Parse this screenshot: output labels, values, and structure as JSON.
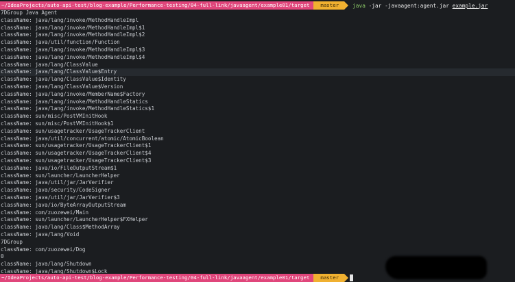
{
  "prompt_top": {
    "path": "~/IdeaProjects/auto-api-test/blog-example/Performance-testing/04-full-link/javaagent/example01/target",
    "branch": "master",
    "cmd_java": "java",
    "cmd_args": "-jar -javaagent:agent.jar",
    "cmd_file": "example.jar"
  },
  "output_lines": [
    "7DGroup Java Agent",
    "className: java/lang/invoke/MethodHandleImpl",
    "className: java/lang/invoke/MethodHandleImpl$1",
    "className: java/lang/invoke/MethodHandleImpl$2",
    "className: java/util/function/Function",
    "className: java/lang/invoke/MethodHandleImpl$3",
    "className: java/lang/invoke/MethodHandleImpl$4",
    "className: java/lang/ClassValue",
    "className: java/lang/ClassValue$Entry",
    "className: java/lang/ClassValue$Identity",
    "className: java/lang/ClassValue$Version",
    "className: java/lang/invoke/MemberName$Factory",
    "className: java/lang/invoke/MethodHandleStatics",
    "className: java/lang/invoke/MethodHandleStatics$1",
    "className: sun/misc/PostVMInitHook",
    "className: sun/misc/PostVMInitHook$1",
    "className: sun/usagetracker/UsageTrackerClient",
    "className: java/util/concurrent/atomic/AtomicBoolean",
    "className: sun/usagetracker/UsageTrackerClient$1",
    "className: sun/usagetracker/UsageTrackerClient$4",
    "className: sun/usagetracker/UsageTrackerClient$3",
    "className: java/io/FileOutputStream$1",
    "className: sun/launcher/LauncherHelper",
    "className: java/util/jar/JarVerifier",
    "className: java/security/CodeSigner",
    "className: java/util/jar/JarVerifier$3",
    "className: java/io/ByteArrayOutputStream",
    "className: com/zuozewei/Main",
    "className: sun/launcher/LauncherHelper$FXHelper",
    "className: java/lang/Class$MethodArray",
    "className: java/lang/Void",
    "7DGroup",
    "className: com/zuozewei/Dog",
    "0",
    "className: java/lang/Shutdown",
    "className: java/lang/Shutdown$Lock"
  ],
  "prompt_bottom": {
    "path": "~/IdeaProjects/auto-api-test/blog-example/Performance-testing/04-full-link/javaagent/example01/target",
    "branch": "master"
  }
}
